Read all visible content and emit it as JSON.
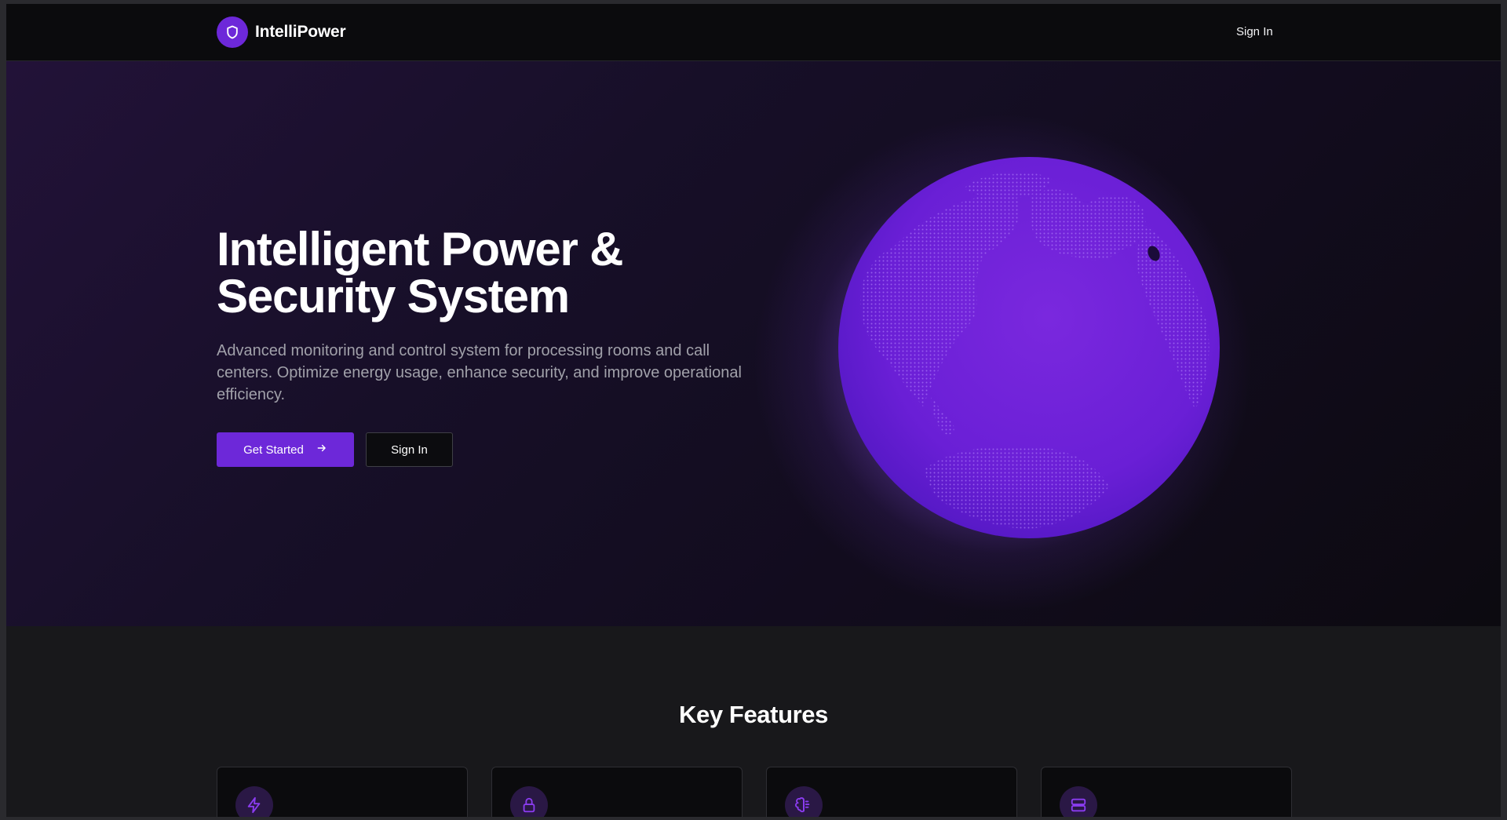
{
  "navbar": {
    "brand_name": "IntelliPower",
    "brand_icon": "shield-icon",
    "signin_label": "Sign In"
  },
  "hero": {
    "title": "Intelligent Power &\nSecurity System",
    "subtitle": "Advanced monitoring and control system for processing rooms and call centers. Optimize energy usage, enhance security, and improve operational efficiency.",
    "primary_button": {
      "label": "Get Started",
      "icon": "arrow-right-icon"
    },
    "secondary_button": {
      "label": "Sign In"
    },
    "visual": "globe"
  },
  "features": {
    "title": "Key Features",
    "cards": [
      {
        "icon": "lightning-bolt-icon"
      },
      {
        "icon": "lock-icon"
      },
      {
        "icon": "brain-icon"
      },
      {
        "icon": "server-icon"
      }
    ]
  },
  "colors": {
    "accent": "#6d28d9",
    "nav_background": "#0b0b0d",
    "page_background": "#18181b",
    "muted_text": "#a1a1aa",
    "globe": "#6a1fd6"
  }
}
